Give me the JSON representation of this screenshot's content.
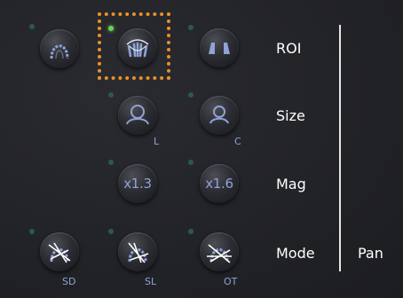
{
  "roi": {
    "label": "ROI",
    "buttons": [
      {
        "icon": "full-arch-icon",
        "active": false
      },
      {
        "icon": "anterior-teeth-icon",
        "active": true
      },
      {
        "icon": "tmj-icon",
        "active": false
      }
    ]
  },
  "size": {
    "label": "Size",
    "buttons": [
      {
        "icon": "head-icon",
        "caption": "L"
      },
      {
        "icon": "head-icon",
        "caption": "C"
      }
    ]
  },
  "mag": {
    "label": "Mag",
    "buttons": [
      {
        "text": "x1.3"
      },
      {
        "text": "x1.6"
      }
    ]
  },
  "mode": {
    "label": "Mode",
    "value": "Pan",
    "buttons": [
      {
        "icon": "scan-mode-icon",
        "caption": "SD"
      },
      {
        "icon": "scan-mode-icon",
        "caption": "SL"
      },
      {
        "icon": "scan-mode-icon",
        "caption": "OT"
      }
    ]
  },
  "colors": {
    "background": "#222327",
    "icon": "#8ea3d6",
    "led_on": "#67d35a",
    "led_off": "#2a5a4f",
    "selection": "#e8912a",
    "label": "#ffffff"
  }
}
